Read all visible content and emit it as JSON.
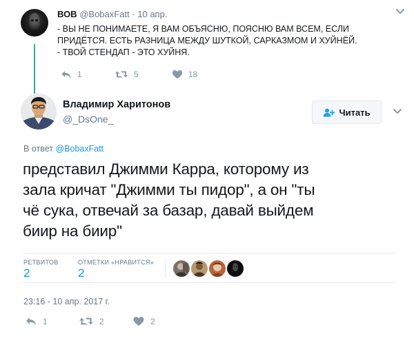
{
  "parent_tweet": {
    "author_name": "ВОВ",
    "handle": "@BobaxFatt",
    "separator": "·",
    "date": "10 апр.",
    "text_lines": [
      "- ВЫ НЕ ПОНИМАЕТЕ, Я ВАМ ОБЪЯСНЮ, ПОЯСНЮ ВАМ ВСЕМ, ЕСЛИ",
      "ПРИДЁТСЯ. ЕСТЬ РАЗНИЦА МЕЖДУ ШУТКОЙ, САРКАЗМОМ И ХУЙНЁЙ.",
      "- ТВОЙ СТЕНДАП - ЭТО ХУЙНЯ."
    ],
    "actions": {
      "replies": "1",
      "retweets": "5",
      "likes": "18"
    }
  },
  "main_tweet": {
    "author_name": "Владимир Харитонов",
    "handle": "@_DsOne_",
    "follow_label": "Читать",
    "reply_prefix": "В ответ",
    "reply_to": "@BobaxFatt",
    "text_lines": [
      "представил Джимми Карра, которому из",
      "зала кричат \"Джимми ты пидор\", а он \"ты",
      "чё сука, отвечай за базар, давай выйдем",
      "биир на биир\""
    ],
    "stats": {
      "retweets_label": "РЕТВИТОВ",
      "retweets_value": "2",
      "likes_label": "ОТМЕТКИ «НРАВИТСЯ»",
      "likes_value": "2"
    },
    "timestamp": "23:16 - 10 апр. 2017 г.",
    "actions": {
      "replies": "1",
      "retweets": "2",
      "likes": "2"
    }
  },
  "colors": {
    "link_blue": "#1b95e0",
    "secondary_text": "#657786",
    "icon_gray": "#8899a6",
    "thread_line": "#4d9e8f"
  },
  "icons": [
    "reply-icon",
    "retweet-icon",
    "heart-icon",
    "chevron-down-icon",
    "follow-icon"
  ]
}
